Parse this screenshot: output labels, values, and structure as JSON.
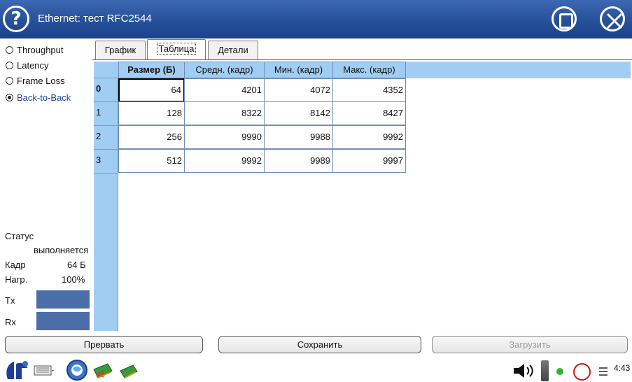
{
  "window": {
    "title": "Ethernet: тест RFC2544",
    "help_glyph": "?"
  },
  "tests": [
    {
      "label": "Throughput",
      "selected": false
    },
    {
      "label": "Latency",
      "selected": false
    },
    {
      "label": "Frame Loss",
      "selected": false
    },
    {
      "label": "Back-to-Back",
      "selected": true
    }
  ],
  "status": {
    "label": "Статус",
    "value": "выполняется",
    "frame_label": "Кадр",
    "frame_value": "64 Б",
    "load_label": "Нагр.",
    "load_value": "100%",
    "tx_label": "Tx",
    "rx_label": "Rx"
  },
  "tabs": [
    {
      "label": "График",
      "active": false
    },
    {
      "label": "Таблица",
      "active": true
    },
    {
      "label": "Детали",
      "active": false
    }
  ],
  "table": {
    "columns": [
      "Размер (Б)",
      "Средн. (кадр)",
      "Мин. (кадр)",
      "Макс. (кадр)"
    ],
    "rows": [
      {
        "index": "0",
        "cells": [
          "64",
          "4201",
          "4072",
          "4352"
        ]
      },
      {
        "index": "1",
        "cells": [
          "128",
          "8322",
          "8142",
          "8427"
        ]
      },
      {
        "index": "2",
        "cells": [
          "256",
          "9990",
          "9988",
          "9992"
        ]
      },
      {
        "index": "3",
        "cells": [
          "512",
          "9992",
          "9989",
          "9997"
        ]
      }
    ]
  },
  "buttons": {
    "abort": "Прервать",
    "save": "Сохранить",
    "load": "Загрузить"
  },
  "taskbar": {
    "clock": "4:43",
    "icons": [
      "app-menu-icon",
      "keyboard-icon",
      "network-globe-icon",
      "network-card-icon",
      "network-card-2-icon",
      "speaker-icon",
      "battery-icon",
      "status-led-icon",
      "record-icon",
      "menu-lines-icon"
    ]
  },
  "colors": {
    "titlebar": "#2a549e",
    "table_header": "#a2cdf3",
    "status_bar": "#4b6ea8"
  }
}
